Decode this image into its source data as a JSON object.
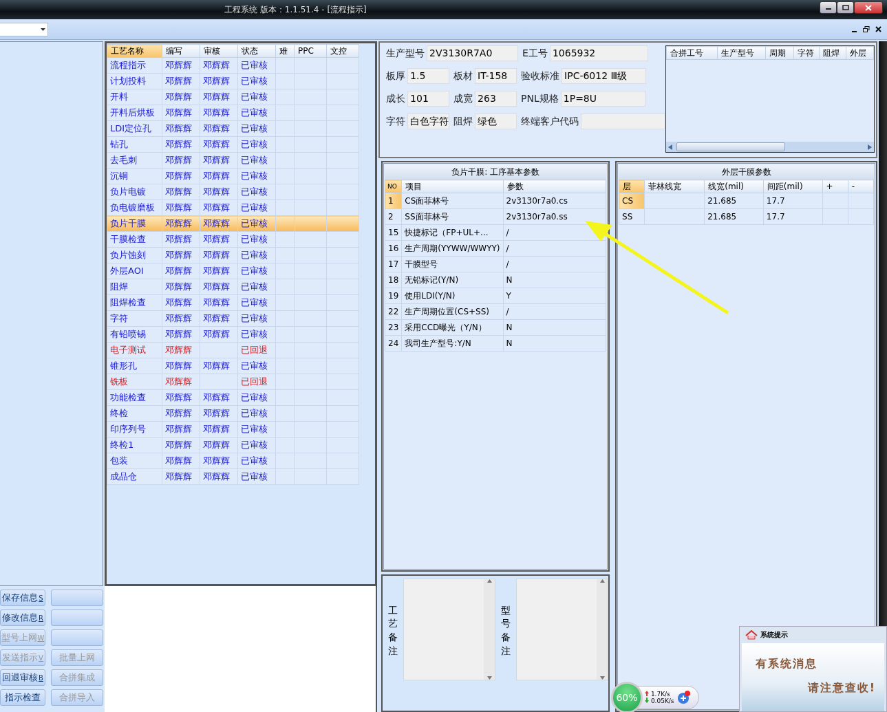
{
  "window": {
    "title": "工程系统    版本：1.1.51.4 - [流程指示]"
  },
  "process_table": {
    "columns": [
      "工艺名称",
      "编写",
      "审核",
      "状态",
      "难",
      "PPC",
      "文控"
    ],
    "rows": [
      {
        "name": "流程指示",
        "writer": "邓辉辉",
        "reviewer": "邓辉辉",
        "status": "已审核",
        "returned": false,
        "selected": false
      },
      {
        "name": "计划投料",
        "writer": "邓辉辉",
        "reviewer": "邓辉辉",
        "status": "已审核",
        "returned": false,
        "selected": false
      },
      {
        "name": "开料",
        "writer": "邓辉辉",
        "reviewer": "邓辉辉",
        "status": "已审核",
        "returned": false,
        "selected": false
      },
      {
        "name": "开料后烘板",
        "writer": "邓辉辉",
        "reviewer": "邓辉辉",
        "status": "已审核",
        "returned": false,
        "selected": false
      },
      {
        "name": "LDI定位孔",
        "writer": "邓辉辉",
        "reviewer": "邓辉辉",
        "status": "已审核",
        "returned": false,
        "selected": false
      },
      {
        "name": "钻孔",
        "writer": "邓辉辉",
        "reviewer": "邓辉辉",
        "status": "已审核",
        "returned": false,
        "selected": false
      },
      {
        "name": "去毛刺",
        "writer": "邓辉辉",
        "reviewer": "邓辉辉",
        "status": "已审核",
        "returned": false,
        "selected": false
      },
      {
        "name": "沉铜",
        "writer": "邓辉辉",
        "reviewer": "邓辉辉",
        "status": "已审核",
        "returned": false,
        "selected": false
      },
      {
        "name": "负片电镀",
        "writer": "邓辉辉",
        "reviewer": "邓辉辉",
        "status": "已审核",
        "returned": false,
        "selected": false
      },
      {
        "name": "负电镀磨板",
        "writer": "邓辉辉",
        "reviewer": "邓辉辉",
        "status": "已审核",
        "returned": false,
        "selected": false
      },
      {
        "name": "负片干膜",
        "writer": "邓辉辉",
        "reviewer": "邓辉辉",
        "status": "已审核",
        "returned": false,
        "selected": true
      },
      {
        "name": "干膜检查",
        "writer": "邓辉辉",
        "reviewer": "邓辉辉",
        "status": "已审核",
        "returned": false,
        "selected": false
      },
      {
        "name": "负片蚀刻",
        "writer": "邓辉辉",
        "reviewer": "邓辉辉",
        "status": "已审核",
        "returned": false,
        "selected": false
      },
      {
        "name": "外层AOI",
        "writer": "邓辉辉",
        "reviewer": "邓辉辉",
        "status": "已审核",
        "returned": false,
        "selected": false
      },
      {
        "name": "阻焊",
        "writer": "邓辉辉",
        "reviewer": "邓辉辉",
        "status": "已审核",
        "returned": false,
        "selected": false
      },
      {
        "name": "阻焊检查",
        "writer": "邓辉辉",
        "reviewer": "邓辉辉",
        "status": "已审核",
        "returned": false,
        "selected": false
      },
      {
        "name": "字符",
        "writer": "邓辉辉",
        "reviewer": "邓辉辉",
        "status": "已审核",
        "returned": false,
        "selected": false
      },
      {
        "name": "有铅喷锡",
        "writer": "邓辉辉",
        "reviewer": "邓辉辉",
        "status": "已审核",
        "returned": false,
        "selected": false
      },
      {
        "name": "电子测试",
        "writer": "邓辉辉",
        "status": "已回退",
        "returned": true,
        "selected": false
      },
      {
        "name": "锥形孔",
        "writer": "邓辉辉",
        "reviewer": "邓辉辉",
        "status": "已审核",
        "returned": false,
        "selected": false
      },
      {
        "name": "铣板",
        "writer": "邓辉辉",
        "status": "已回退",
        "returned": true,
        "selected": false
      },
      {
        "name": "功能检查",
        "writer": "邓辉辉",
        "reviewer": "邓辉辉",
        "status": "已审核",
        "returned": false,
        "selected": false
      },
      {
        "name": "终检",
        "writer": "邓辉辉",
        "reviewer": "邓辉辉",
        "status": "已审核",
        "returned": false,
        "selected": false
      },
      {
        "name": "印序列号",
        "writer": "邓辉辉",
        "reviewer": "邓辉辉",
        "status": "已审核",
        "returned": false,
        "selected": false
      },
      {
        "name": "终检1",
        "writer": "邓辉辉",
        "reviewer": "邓辉辉",
        "status": "已审核",
        "returned": false,
        "selected": false
      },
      {
        "name": "包装",
        "writer": "邓辉辉",
        "reviewer": "邓辉辉",
        "status": "已审核",
        "returned": false,
        "selected": false
      },
      {
        "name": "成品仓",
        "writer": "邓辉辉",
        "reviewer": "邓辉辉",
        "status": "已审核",
        "returned": false,
        "selected": false
      }
    ]
  },
  "buttons": [
    {
      "kind": "action",
      "label": "保存信息",
      "key": "S",
      "disabled": false
    },
    {
      "kind": "blank"
    },
    {
      "kind": "action",
      "label": "修改信息",
      "key": "R",
      "disabled": false
    },
    {
      "kind": "blank"
    },
    {
      "kind": "action",
      "label": "型号上网",
      "key": "W",
      "disabled": true
    },
    {
      "kind": "blank"
    },
    {
      "kind": "action",
      "label": "发送指示",
      "key": "V",
      "disabled": true
    },
    {
      "kind": "action",
      "label": "批量上网",
      "disabled": true
    },
    {
      "kind": "action",
      "label": "回退审核",
      "key": "B",
      "disabled": false
    },
    {
      "kind": "action",
      "label": "合拼集成",
      "disabled": true
    },
    {
      "kind": "action",
      "label": "指示检查",
      "disabled": false
    },
    {
      "kind": "action",
      "label": "合拼导入",
      "disabled": true
    }
  ],
  "info": [
    [
      {
        "label": "生产型号",
        "value": "2V3130R7A0"
      },
      {
        "label": "E工号",
        "value": "1065932"
      }
    ],
    [
      {
        "label": "板厚",
        "value": "1.5"
      },
      {
        "label": "板材",
        "value": "IT-158"
      },
      {
        "label": "验收标准",
        "value": "IPC-6012 Ⅲ级"
      }
    ],
    [
      {
        "label": "成长",
        "value": "101"
      },
      {
        "label": "成宽",
        "value": "263"
      },
      {
        "label": "PNL规格",
        "value": "1P=8U"
      }
    ],
    [
      {
        "label": "字符",
        "value": "白色字符"
      },
      {
        "label": "阻焊",
        "value": "绿色"
      },
      {
        "label": "终端客户代码"
      }
    ]
  ],
  "merge_table": {
    "columns": [
      "合拼工号",
      "生产型号",
      "周期",
      "字符",
      "阻焊",
      "外层"
    ]
  },
  "param_panel": {
    "title": "负片干膜: 工序基本参数",
    "columns": [
      "NO",
      "项目",
      "参数"
    ],
    "rows": [
      {
        "no": "1",
        "item": "CS面菲林号",
        "value": "2v3130r7a0.cs",
        "current": true
      },
      {
        "no": "2",
        "item": "SS面菲林号",
        "value": "2v3130r7a0.ss",
        "current": false
      },
      {
        "no": "15",
        "item": "快捷标记（FP+UL+...",
        "value": "/",
        "current": false
      },
      {
        "no": "16",
        "item": "生产周期(YYWW/WWYY)",
        "value": "/",
        "current": false
      },
      {
        "no": "17",
        "item": "干膜型号",
        "value": "/",
        "current": false
      },
      {
        "no": "18",
        "item": "无铅标记(Y/N)",
        "value": "N",
        "current": false
      },
      {
        "no": "19",
        "item": "使用LDI(Y/N)",
        "value": "Y",
        "current": false
      },
      {
        "no": "22",
        "item": "生产周期位置(CS+SS)",
        "value": "/",
        "current": false
      },
      {
        "no": "23",
        "item": "采用CCD曝光（Y/N）",
        "value": "N",
        "current": false
      },
      {
        "no": "24",
        "item": "我司生产型号:Y/N",
        "value": "N",
        "current": false
      }
    ]
  },
  "outer_panel": {
    "title": "外层干膜参数",
    "columns": [
      "层",
      "菲林线宽",
      "线宽(mil)",
      "间距(mil)",
      "+",
      "-"
    ],
    "rows": [
      {
        "cells": [
          "CS",
          "",
          "21.685",
          "17.7",
          "",
          ""
        ],
        "current": true
      },
      {
        "cells": [
          "SS",
          "",
          "21.685",
          "17.7",
          "",
          ""
        ],
        "current": false
      }
    ]
  },
  "remarks": [
    {
      "label": "工艺备注"
    },
    {
      "label": "型号备注"
    }
  ],
  "net_widget": {
    "percent": "60%",
    "up": "1.7K/s",
    "down": "0.05K/s"
  },
  "notice": {
    "title": "系统提示",
    "line_1": "有系统消息",
    "line_2": "请注意查收!"
  }
}
